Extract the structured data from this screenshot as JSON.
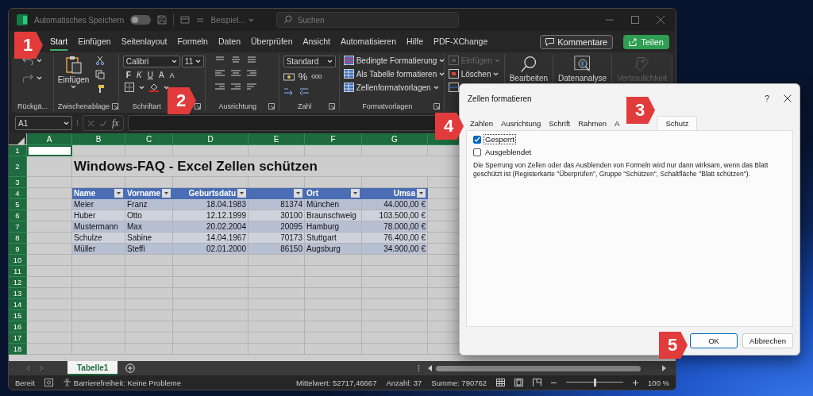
{
  "title_bar": {
    "autosave_label": "Automatisches Speichern",
    "autosave_on": false,
    "file_name": "Beispiel...",
    "search": {
      "placeholder": "Suchen"
    }
  },
  "tabs": [
    {
      "label": "Start",
      "selected": true
    },
    {
      "label": "Einfügen",
      "selected": false
    },
    {
      "label": "Seitenlayout",
      "selected": false
    },
    {
      "label": "Formeln",
      "selected": false
    },
    {
      "label": "Daten",
      "selected": false
    },
    {
      "label": "Überprüfen",
      "selected": false
    },
    {
      "label": "Ansicht",
      "selected": false
    },
    {
      "label": "Automatisieren",
      "selected": false
    },
    {
      "label": "Hilfe",
      "selected": false
    },
    {
      "label": "PDF-XChange",
      "selected": false
    }
  ],
  "tab_actions": {
    "comments": "Kommentare",
    "share": "Teilen"
  },
  "ribbon": {
    "undo": {
      "label": "Rückgä..."
    },
    "clipboard": {
      "paste": "Einfügen",
      "label": "Zwischenablage"
    },
    "font": {
      "family": "Calibri",
      "size": "11",
      "styles": [
        "F",
        "K",
        "U"
      ],
      "grow": "A",
      "shrink": "A",
      "label": "Schriftart"
    },
    "alignment": {
      "label": "Ausrichtung"
    },
    "number": {
      "format": "Standard",
      "percent": "%",
      "thousands": "000",
      "label": "Zahl"
    },
    "styles": {
      "items": [
        "Bedingte Formatierung",
        "Als Tabelle formatieren",
        "Zellenformatvorlagen"
      ],
      "label": "Formatvorlagen"
    },
    "cells": {
      "items": [
        {
          "label": "Einfügen",
          "disabled": true
        },
        {
          "label": "Löschen",
          "disabled": false
        }
      ]
    },
    "tools": [
      {
        "label": "Bearbeiten",
        "disabled": false
      },
      {
        "label": "Datenanalyse",
        "disabled": false
      },
      {
        "label": "Vertraulichkeit",
        "disabled": true
      }
    ]
  },
  "formula_bar": {
    "name_box": "A1",
    "fx": "fx"
  },
  "sheet": {
    "column_headers": [
      "A",
      "B",
      "C",
      "D",
      "E",
      "F",
      "G"
    ],
    "row_headers": [
      "1",
      "2",
      "3",
      "4",
      "5",
      "6",
      "7",
      "8",
      "9",
      "10",
      "11",
      "12",
      "13",
      "14",
      "15",
      "16",
      "17",
      "18"
    ],
    "title": "Windows-FAQ - Excel Zellen schützen",
    "table": {
      "columns": [
        {
          "label": "Name"
        },
        {
          "label": "Vorname"
        },
        {
          "label": "Geburtsdatu"
        },
        {},
        {
          "label": "Ort"
        },
        {
          "label": "Umsa"
        }
      ],
      "rows": [
        [
          "Meier",
          "Franz",
          "18.04.1983",
          "81374",
          "München",
          "44.000,00 €"
        ],
        [
          "Huber",
          "Otto",
          "12.12.1999",
          "30100",
          "Braunschweig",
          "103.500,00 €"
        ],
        [
          "Mustermann",
          "Max",
          "20.02.2004",
          "20095",
          "Hamburg",
          "78.000,00 €"
        ],
        [
          "Schulze",
          "Sabine",
          "14.04.1967",
          "70173",
          "Stuttgart",
          "76.400,00 €"
        ],
        [
          "Müller",
          "Steffi",
          "02.01.2000",
          "86150",
          "Augsburg",
          "34.900,00 €"
        ]
      ]
    }
  },
  "sheet_tabs": [
    {
      "label": "Tabelle1",
      "selected": true
    }
  ],
  "status_bar": {
    "mode": "Bereit",
    "accessibility": "Barrierefreiheit: Keine Probleme",
    "average": "Mittelwert: 52717,46667",
    "count": "Anzahl: 37",
    "sum": "Summe: 790762",
    "zoom": {
      "level": 0.5,
      "reading": "100 %"
    }
  },
  "dialog": {
    "title": "Zellen formatieren",
    "help": "?",
    "tabs": [
      {
        "label": "Zahlen",
        "selected": false
      },
      {
        "label": "Ausrichtung",
        "selected": false
      },
      {
        "label": "Schrift",
        "selected": false
      },
      {
        "label": "Rahmen",
        "selected": false
      },
      {
        "label": "A",
        "selected": false
      },
      {
        "label": "Schutz",
        "selected": true
      }
    ],
    "options": [
      {
        "label": "Gesperrt",
        "checked": true,
        "focused": true
      },
      {
        "label": "Ausgeblendet",
        "checked": false,
        "focused": false
      }
    ],
    "note": "Die Sperrung von Zellen oder das Ausblenden von Formeln wird nur dann wirksam, wenn das Blatt geschützt ist (Registerkarte \"Überprüfen\", Gruppe \"Schützen\", Schaltfläche \"Blatt schützen\").",
    "buttons": [
      {
        "label": "OK",
        "default": true
      },
      {
        "label": "Abbrechen",
        "default": false
      }
    ]
  },
  "badges": [
    {
      "label": "1"
    },
    {
      "label": "2"
    },
    {
      "label": "3"
    },
    {
      "label": "4"
    },
    {
      "label": "5"
    }
  ]
}
